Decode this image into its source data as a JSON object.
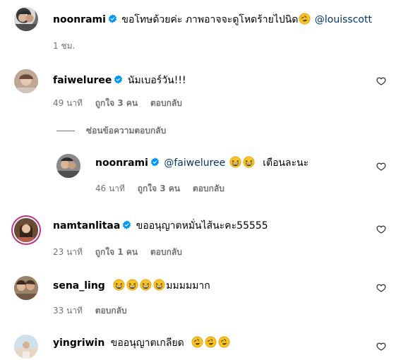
{
  "comments": [
    {
      "username": "noonrami",
      "verified": true,
      "text": "ขอโทษด้วยค่ะ ภาพอาจจะดูโหดร้ายไปนิด",
      "emoji_name": "rofl-emoji",
      "mention": "@louisscott",
      "time": "1 ชม."
    },
    {
      "username": "faiweluree",
      "verified": true,
      "text": "นัมเบอร์วัน!!!",
      "time": "49 นาที",
      "likes": "ถูกใจ 3 คน",
      "reply": "ตอบกลับ"
    },
    {
      "username": "noonrami",
      "verified": true,
      "mention": "@faiweluree",
      "emoji_name": "grinning-squinting-emoji",
      "text": "เตือนละนะ",
      "time": "46 นาที",
      "likes": "ถูกใจ 3 คน",
      "reply": "ตอบกลับ"
    },
    {
      "username": "namtanlitaa",
      "verified": true,
      "text": "ขออนุญาตหมั่นไส้นะคะ55555",
      "time": "23 นาที",
      "likes": "ถูกใจ 1 คน",
      "reply": "ตอบกลับ"
    },
    {
      "username": "sena_ling",
      "verified": false,
      "text": "มมมมมาก",
      "emoji_name": "grinning-squinting-emoji",
      "time": "33 นาที",
      "reply": "ตอบกลับ"
    },
    {
      "username": "yingriwin",
      "verified": false,
      "text": "ขออนุญาตเกลียด",
      "emoji_name": "rofl-emoji"
    }
  ],
  "hide_replies": "ซ่อนข้อความตอบกลับ",
  "colors": {
    "verified": "#0095f6",
    "mention": "#00376b",
    "meta": "#737373",
    "story_ring": "#c13584"
  }
}
